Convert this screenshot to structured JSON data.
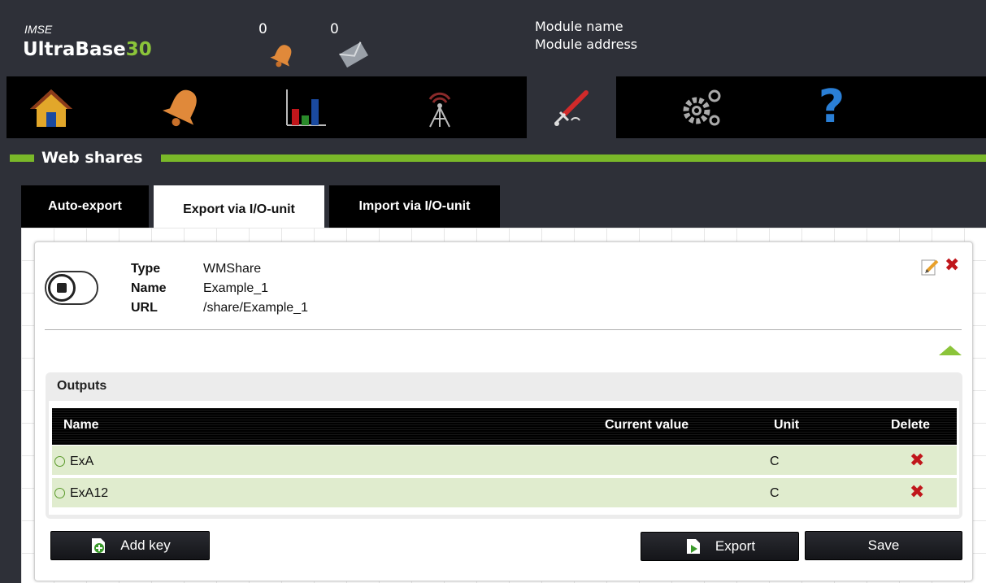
{
  "header": {
    "brand_top": "IMSE",
    "brand_main": "UltraBase",
    "brand_num": "30",
    "alarm_count": "0",
    "message_count": "0",
    "module_name": "Module name",
    "module_address": "Module address"
  },
  "nav": {
    "items": [
      {
        "icon": "home-icon"
      },
      {
        "icon": "alarm-bell-icon"
      },
      {
        "icon": "bar-chart-icon"
      },
      {
        "icon": "antenna-icon"
      },
      {
        "icon": "tools-icon",
        "active": true
      },
      {
        "icon": "gears-icon"
      },
      {
        "icon": "help-icon"
      }
    ]
  },
  "section": {
    "title": "Web shares"
  },
  "tabs": [
    {
      "label": "Auto-export"
    },
    {
      "label": "Export via I/O-unit",
      "active": true
    },
    {
      "label": "Import via I/O-unit"
    }
  ],
  "share": {
    "type_label": "Type",
    "type_value": "WMShare",
    "name_label": "Name",
    "name_value": "Example_1",
    "url_label": "URL",
    "url_value": "/share/Example_1"
  },
  "outputs": {
    "title": "Outputs",
    "columns": [
      "Name",
      "Current value",
      "Unit",
      "Delete"
    ],
    "rows": [
      {
        "name": "ExA",
        "current_value": "",
        "unit": "C"
      },
      {
        "name": "ExA12",
        "current_value": "",
        "unit": "C"
      }
    ]
  },
  "buttons": {
    "add_key": "Add key",
    "export": "Export",
    "save": "Save"
  },
  "colors": {
    "accent_green": "#7ab829",
    "background": "#2e3038",
    "delete_red": "#c0161b",
    "row_green": "#e0ecce"
  }
}
